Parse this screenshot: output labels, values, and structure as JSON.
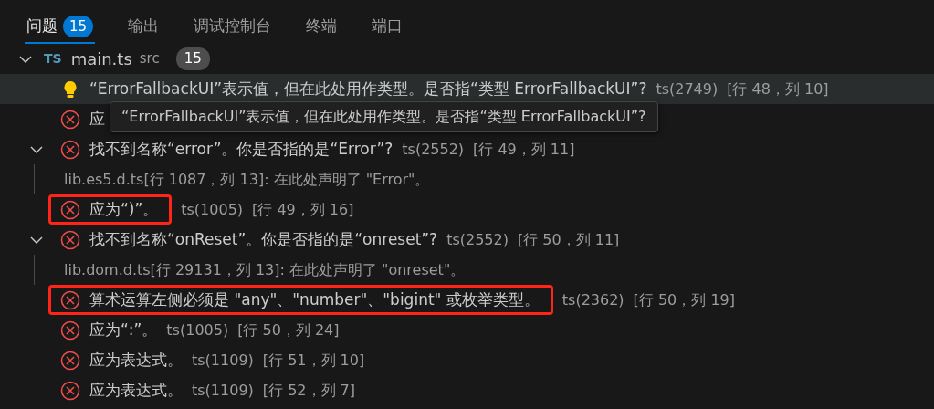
{
  "tabs": [
    {
      "label": "问题",
      "badge": "15",
      "selected": true
    },
    {
      "label": "输出",
      "selected": false
    },
    {
      "label": "调试控制台",
      "selected": false
    },
    {
      "label": "终端",
      "selected": false
    },
    {
      "label": "端口",
      "selected": false
    }
  ],
  "file": {
    "icon": "TS",
    "name": "main.ts",
    "folder": "src",
    "count": "15",
    "expanded": true
  },
  "problems": [
    {
      "kind": "warning",
      "message": "“ErrorFallbackUI”表示值，但在此处用作类型。是否指“类型 ErrorFallbackUI”?",
      "code": "ts(2749)",
      "location": "[行 48，列 10]",
      "selected": true,
      "highlighted": false
    },
    {
      "kind": "error",
      "message": "应",
      "selected": false,
      "highlighted": false
    },
    {
      "kind": "error",
      "message": "找不到名称“error”。你是否指的是“Error”?",
      "code": "ts(2552)",
      "location": "[行 49，列 11]",
      "selected": false,
      "highlighted": false,
      "expanded": true,
      "children": [
        {
          "kind": "related",
          "message": "lib.es5.d.ts[行 1087，列 13]: 在此处声明了 \"Error\"。",
          "selected": false,
          "highlighted": false
        }
      ]
    },
    {
      "kind": "error",
      "message": "应为“)”。",
      "code": "ts(1005)",
      "location": "[行 49，列 16]",
      "selected": false,
      "highlighted": true
    },
    {
      "kind": "error",
      "message": "找不到名称“onReset”。你是否指的是“onreset”?",
      "code": "ts(2552)",
      "location": "[行 50，列 11]",
      "selected": false,
      "highlighted": false,
      "expanded": true,
      "children": [
        {
          "kind": "related",
          "message": "lib.dom.d.ts[行 29131，列 13]: 在此处声明了 \"onreset\"。",
          "selected": false,
          "highlighted": false
        }
      ]
    },
    {
      "kind": "error",
      "message": "算术运算左侧必须是 \"any\"、\"number\"、\"bigint\" 或枚举类型。",
      "code": "ts(2362)",
      "location": "[行 50，列 19]",
      "selected": false,
      "highlighted": true
    },
    {
      "kind": "error",
      "message": "应为“:”。",
      "code": "ts(1005)",
      "location": "[行 50，列 24]",
      "selected": false,
      "highlighted": false
    },
    {
      "kind": "error",
      "message": "应为表达式。",
      "code": "ts(1109)",
      "location": "[行 51，列 10]",
      "selected": false,
      "highlighted": false
    },
    {
      "kind": "error",
      "message": "应为表达式。",
      "code": "ts(1109)",
      "location": "[行 52，列 7]",
      "selected": false,
      "highlighted": false
    }
  ],
  "tooltip": {
    "text": "“ErrorFallbackUI”表示值，但在此处用作类型。是否指“类型 ErrorFallbackUI”?"
  }
}
